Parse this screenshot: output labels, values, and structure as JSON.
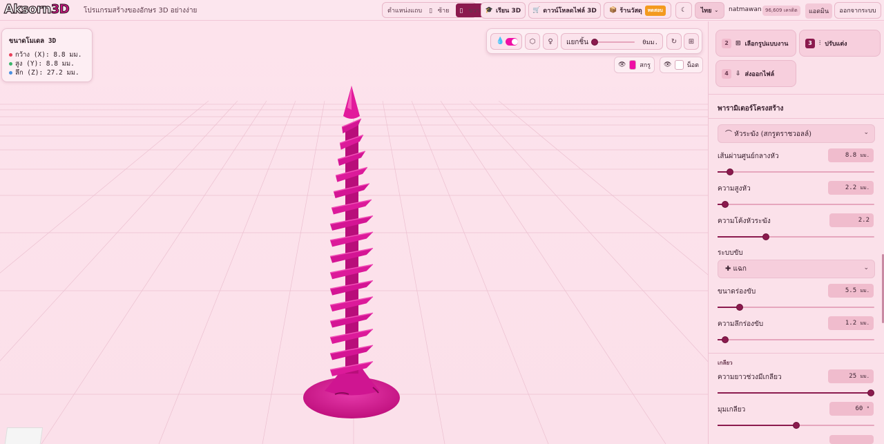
{
  "header": {
    "logo_main": "Aksorn",
    "logo_accent": "3D",
    "tagline": "โปรแกรมสร้างของอักษร 3D อย่างง่าย",
    "position_label": "ตำแหน่งแถบ",
    "left_label": "ซ้าย",
    "right_label": "ขวา",
    "learn_label": "เรียน 3D",
    "download_label": "ดาวน์โหลดไฟล์ 3D",
    "shop_label": "ร้านวัสดุ",
    "shop_badge": "ทดสอบ",
    "language": "ไทย",
    "username": "natmawan",
    "credits": "96,609 เครดิต",
    "admin_label": "แอดมิน",
    "logout_label": "ออกจากระบบ"
  },
  "viewport": {
    "dimensions": {
      "title": "ขนาดโมเดล 3D",
      "width": "กว้าง (X): 8.8 มม.",
      "height": "สูง (Y): 8.8 มม.",
      "depth": "ลึก (Z): 27.2 มม.",
      "colors": {
        "x": "#e8405a",
        "y": "#3bb56b",
        "z": "#4a8fe0"
      }
    },
    "toolbar": {
      "explode_label": "แยกชิ้น",
      "explode_value": "0มม.",
      "explode_fraction": 0
    },
    "visibility": {
      "screw_label": "สกรู",
      "screw_color": "#ef0fa5",
      "nut_label": "น็อต",
      "nut_color": "#ffffff"
    },
    "model_color": "#d41594"
  },
  "sidebar": {
    "steps": [
      {
        "num": "2",
        "label": "เลือกรูปแบบงาน",
        "icon": "grid-icon"
      },
      {
        "num": "3",
        "label": "ปรับแต่ง",
        "icon": "sliders-icon",
        "active": true
      },
      {
        "num": "4",
        "label": "ส่งออกไฟล์",
        "icon": "download-icon"
      }
    ],
    "section_title": "พารามิเตอร์โครงสร้าง",
    "head_type": "⌒ หัวระฆัง (สกรูตราชวอลล์)",
    "params": [
      {
        "label": "เส้นผ่านศูนย์กลางหัว",
        "value": "8.8",
        "unit": "มม.",
        "fraction": 0.08
      },
      {
        "label": "ความสูงหัว",
        "value": "2.2",
        "unit": "มม.",
        "fraction": 0.05
      },
      {
        "label": "ความโค้งหัวระฆัง",
        "value": "2.2",
        "unit": "",
        "fraction": 0.31
      }
    ],
    "drive_label": "ระบบขับ",
    "drive_type": "✚ แฉก",
    "drive_params": [
      {
        "label": "ขนาดร่องขับ",
        "value": "5.5",
        "unit": "มม.",
        "fraction": 0.14
      },
      {
        "label": "ความลึกร่องขับ",
        "value": "1.2",
        "unit": "มม.",
        "fraction": 0.05
      }
    ],
    "thread_heading": "เกลียว",
    "thread_params": [
      {
        "label": "ความยาวช่วงมีเกลียว",
        "value": "25",
        "unit": "มม.",
        "fraction": 0.98
      },
      {
        "label": "มุมเกลียว",
        "value": "60",
        "unit": "°",
        "fraction": 0.5
      }
    ]
  }
}
